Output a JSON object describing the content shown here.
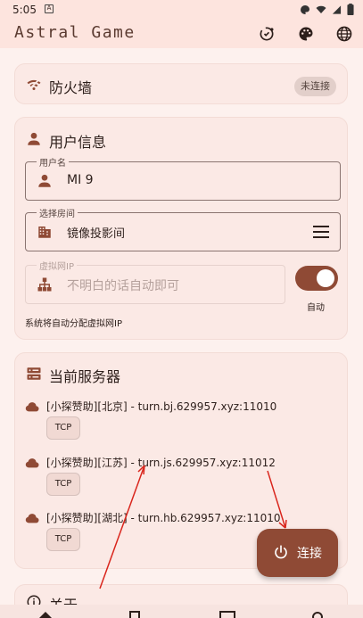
{
  "status_bar": {
    "time": "5:05",
    "notification_letter": "A",
    "icons": [
      "palette-icon",
      "wifi-icon",
      "signal-icon",
      "battery-icon"
    ]
  },
  "app_bar": {
    "title": "Astral Game",
    "actions": [
      "network-check-icon",
      "palette-icon",
      "globe-icon"
    ]
  },
  "firewall_card": {
    "title": "防火墙",
    "badge": "未连接",
    "icon": "wifi-off-icon"
  },
  "user_card": {
    "title": "用户信息",
    "icon": "person-icon",
    "username": {
      "label": "用户名",
      "value": "MI 9",
      "icon": "person-icon"
    },
    "room": {
      "label": "选择房间",
      "value": "镜像投影间",
      "icon": "building-icon",
      "action_icon": "menu-icon"
    },
    "virtual_ip": {
      "label": "虚拟网IP",
      "placeholder": "不明白的话自动即可",
      "icon": "network-tree-icon",
      "disabled": true
    },
    "auto_toggle": {
      "label": "自动",
      "on": true
    },
    "hint": "系统将自动分配虚拟网IP"
  },
  "server_card": {
    "title": "当前服务器",
    "icon": "server-icon",
    "servers": [
      {
        "name": "[小探赞助][北京] - turn.bj.629957.xyz:11010",
        "protocol": "TCP"
      },
      {
        "name": "[小探赞助][江苏] - turn.js.629957.xyz:11012",
        "protocol": "TCP"
      },
      {
        "name": "[小探赞助][湖北] - turn.hb.629957.xyz:11010",
        "protocol": "TCP"
      }
    ]
  },
  "fab": {
    "label": "连接",
    "icon": "power-icon"
  },
  "about_card": {
    "title": "关于",
    "icon": "info-icon"
  },
  "bottom_nav": {
    "items": [
      "home-icon",
      "room-icon",
      "server-list-icon",
      "settings-icon"
    ]
  },
  "colors": {
    "primary": "#8f4a35",
    "background": "#fdf1ee",
    "card": "#fbe9e5",
    "annotation_arrow": "#d9251c"
  }
}
